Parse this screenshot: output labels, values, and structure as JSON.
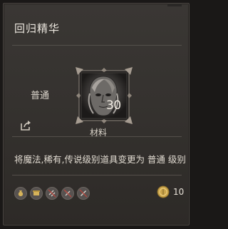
{
  "item": {
    "name": "回归精华",
    "grade": "普通",
    "count": "30",
    "type": "材料",
    "description": "将魔法,稀有,传说级别道具变更为 普通 级别"
  },
  "footer": {
    "icons": [
      "coin-bag-icon",
      "scroll-icon",
      "no-trade-icon",
      "no-repair-icon",
      "no-salvage-icon"
    ],
    "currency_icon": "gold-coin-icon",
    "currency_amount": "10"
  },
  "colors": {
    "panel_bg": "#35322f",
    "frame_border": "#7e7770",
    "gold": "#c9a34a",
    "text": "#e6e0d6"
  }
}
